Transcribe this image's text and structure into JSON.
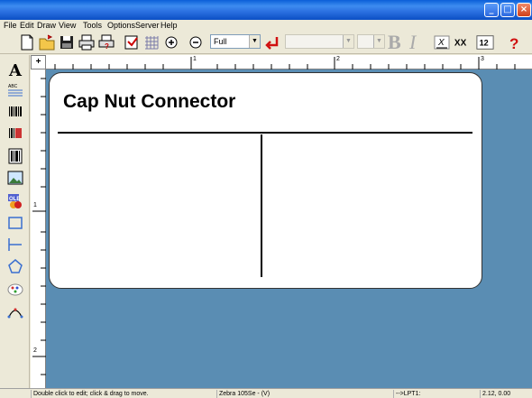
{
  "window": {
    "controls": [
      "minimize-icon",
      "maximize-icon",
      "close-icon"
    ]
  },
  "menu": [
    "File",
    "Edit",
    "Draw",
    "View",
    "Tools",
    "Options",
    "Server",
    "Help"
  ],
  "toolbar": {
    "zoom_value": "Full",
    "font_value": "",
    "size_value": "",
    "bold_label": "B",
    "italic_label": "I",
    "size12_label": "12",
    "xx_label": "XX",
    "x_label": "X",
    "help_label": "?"
  },
  "ruler": {
    "corner_label": "+",
    "h_numbers": [
      "1",
      "2",
      "3"
    ],
    "v_numbers": [
      "1",
      "2"
    ]
  },
  "label": {
    "title": "Cap Nut Connector"
  },
  "status": {
    "hint": "Double click to edit; click & drag to move.",
    "printer": "Zebra 105Se - (V)",
    "port": "-->LPT1:",
    "coords": "2.12, 0.00"
  },
  "colors": {
    "canvas_bg": "#5a8db3",
    "titlebar": "#2a6fe0"
  }
}
